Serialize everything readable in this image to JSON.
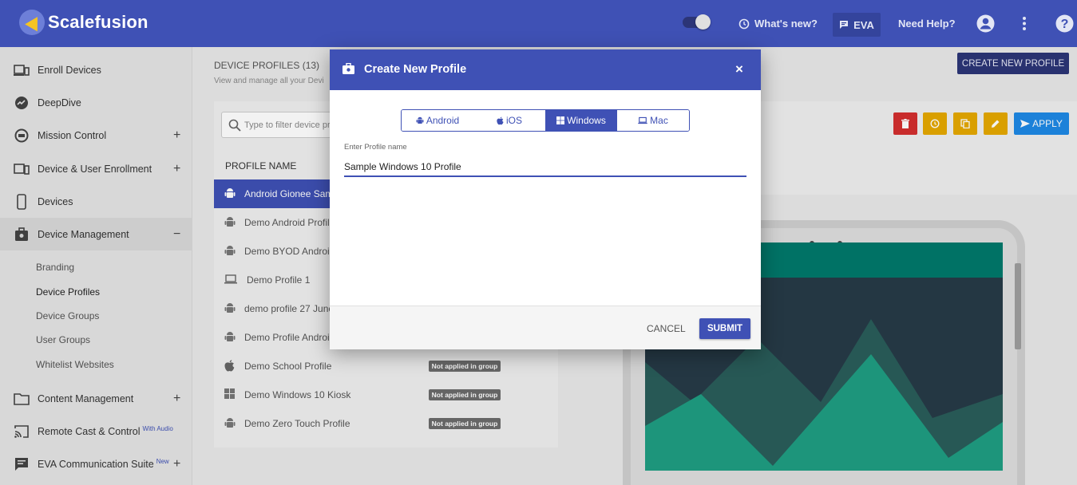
{
  "app": {
    "name": "Scalefusion"
  },
  "topbar": {
    "whats_new": "What's new?",
    "eva": "EVA",
    "need_help": "Need Help?"
  },
  "sidebar": {
    "items": [
      {
        "label": "Enroll Devices",
        "icon": "enroll-devices-icon"
      },
      {
        "label": "DeepDive",
        "icon": "deepdive-icon"
      },
      {
        "label": "Mission Control",
        "icon": "mission-control-icon",
        "toggle": "+"
      },
      {
        "label": "Device & User Enrollment",
        "icon": "device-user-enrollment-icon",
        "toggle": "+"
      },
      {
        "label": "Devices",
        "icon": "devices-icon"
      },
      {
        "label": "Device Management",
        "icon": "device-management-icon",
        "toggle": "−"
      },
      {
        "label": "Content Management",
        "icon": "content-management-icon",
        "toggle": "+"
      },
      {
        "label": "Remote Cast & Control",
        "icon": "cast-icon",
        "sup": "With Audio"
      },
      {
        "label": "EVA Communication Suite",
        "icon": "chat-icon",
        "sup": "New",
        "toggle": "+"
      }
    ],
    "sub_items": [
      "Branding",
      "Device Profiles",
      "Device Groups",
      "User Groups",
      "Whitelist Websites"
    ]
  },
  "page": {
    "title": "DEVICE PROFILES (13)",
    "subtitle": "View and manage all your Devi",
    "create_button": "CREATE NEW PROFILE",
    "filter_placeholder": "Type to filter device pro",
    "column_header": "PROFILE NAME",
    "apply_button": "APPLY",
    "rows": [
      {
        "label": "Android Gionee Sam",
        "icon": "android-icon",
        "badge": ""
      },
      {
        "label": "Demo Android Profile",
        "icon": "android-icon",
        "badge": ""
      },
      {
        "label": "Demo BYOD Android",
        "icon": "android-icon",
        "badge": ""
      },
      {
        "label": "Demo Profile 1",
        "icon": "laptop-icon",
        "badge": ""
      },
      {
        "label": "demo profile 27 June",
        "icon": "android-icon",
        "badge": ""
      },
      {
        "label": "Demo Profile Android",
        "icon": "android-icon",
        "badge": ""
      },
      {
        "label": "Demo School Profile",
        "icon": "apple-icon",
        "badge": "Not applied in group"
      },
      {
        "label": "Demo Windows 10 Kiosk",
        "icon": "windows-icon",
        "badge": "Not applied in group"
      },
      {
        "label": "Demo Zero Touch Profile",
        "icon": "android-icon",
        "badge": "Not applied in group"
      }
    ]
  },
  "dialog": {
    "title": "Create New Profile",
    "close": "×",
    "tabs": [
      {
        "label": "Android",
        "icon": "android-icon"
      },
      {
        "label": "iOS",
        "icon": "apple-icon"
      },
      {
        "label": "Windows",
        "icon": "windows-icon",
        "active": true
      },
      {
        "label": "Mac",
        "icon": "laptop-icon"
      }
    ],
    "field_label": "Enter Profile name",
    "field_value": "Sample Windows 10 Profile",
    "cancel": "CANCEL",
    "submit": "SUBMIT"
  },
  "colors": {
    "primary": "#3f51b5",
    "dark_primary": "#2c3577",
    "delete": "#d32f2f",
    "amber": "#e5a800",
    "apply": "#1e88e5",
    "screen_teal": "#00796b"
  }
}
